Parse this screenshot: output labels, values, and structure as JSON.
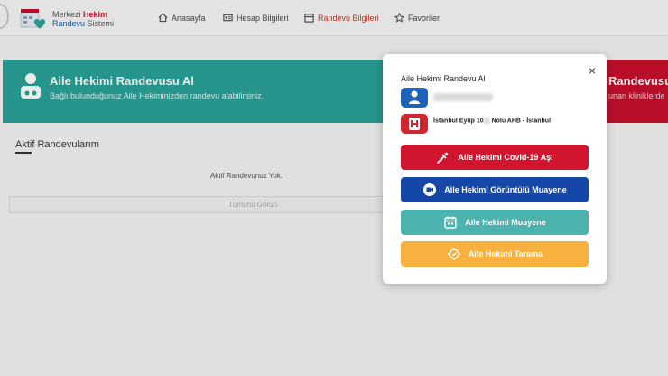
{
  "header": {
    "logo_line1_a": "Merkezi ",
    "logo_line1_b": "Hekim",
    "logo_line2_a": "Randevu",
    "logo_line2_b": " Sistemi",
    "nav": [
      {
        "label": "Anasayfa",
        "icon": "home-icon"
      },
      {
        "label": "Hesap Bilgileri",
        "icon": "id-card-icon"
      },
      {
        "label": "Randevu Bilgileri",
        "icon": "calendar-icon",
        "active": true
      },
      {
        "label": "Favoriler",
        "icon": "star-icon"
      }
    ]
  },
  "banner": {
    "title": "Aile Hekimi Randevusu Al",
    "subtitle": "Bağlı bulunduğunuz Aile Hekiminizden randevu alabilirsiniz.",
    "color": "#2aa39a"
  },
  "banner_right": {
    "title": "Randevusu Al",
    "subtitle": "unan kliniklerde",
    "color": "#c8102e"
  },
  "appointments": {
    "title": "Aktif Randevularım",
    "empty_text": "Aktif Randevunuz Yok.",
    "show_all_label": "Tümünü Görün"
  },
  "modal": {
    "title": "Aile Hekimi Randevu Al",
    "close_label": "×",
    "hospital_prefix": "İstanbul Eyüp 10",
    "hospital_suffix": " Nolu AHB - İstanbul",
    "buttons": [
      {
        "label": "Aile Hekimi Covid-19 Aşı",
        "color": "#d1152f",
        "icon": "syringe-icon"
      },
      {
        "label": "Aile Hekimi Görüntülü Muayene",
        "color": "#1447a8",
        "icon": "chat-icon"
      },
      {
        "label": "Aile Hekimi Muayene",
        "color": "#4cb3ae",
        "icon": "calendar-icon"
      },
      {
        "label": "Aile Hekimi Tarama",
        "color": "#f8b13e",
        "icon": "scan-icon"
      }
    ]
  }
}
